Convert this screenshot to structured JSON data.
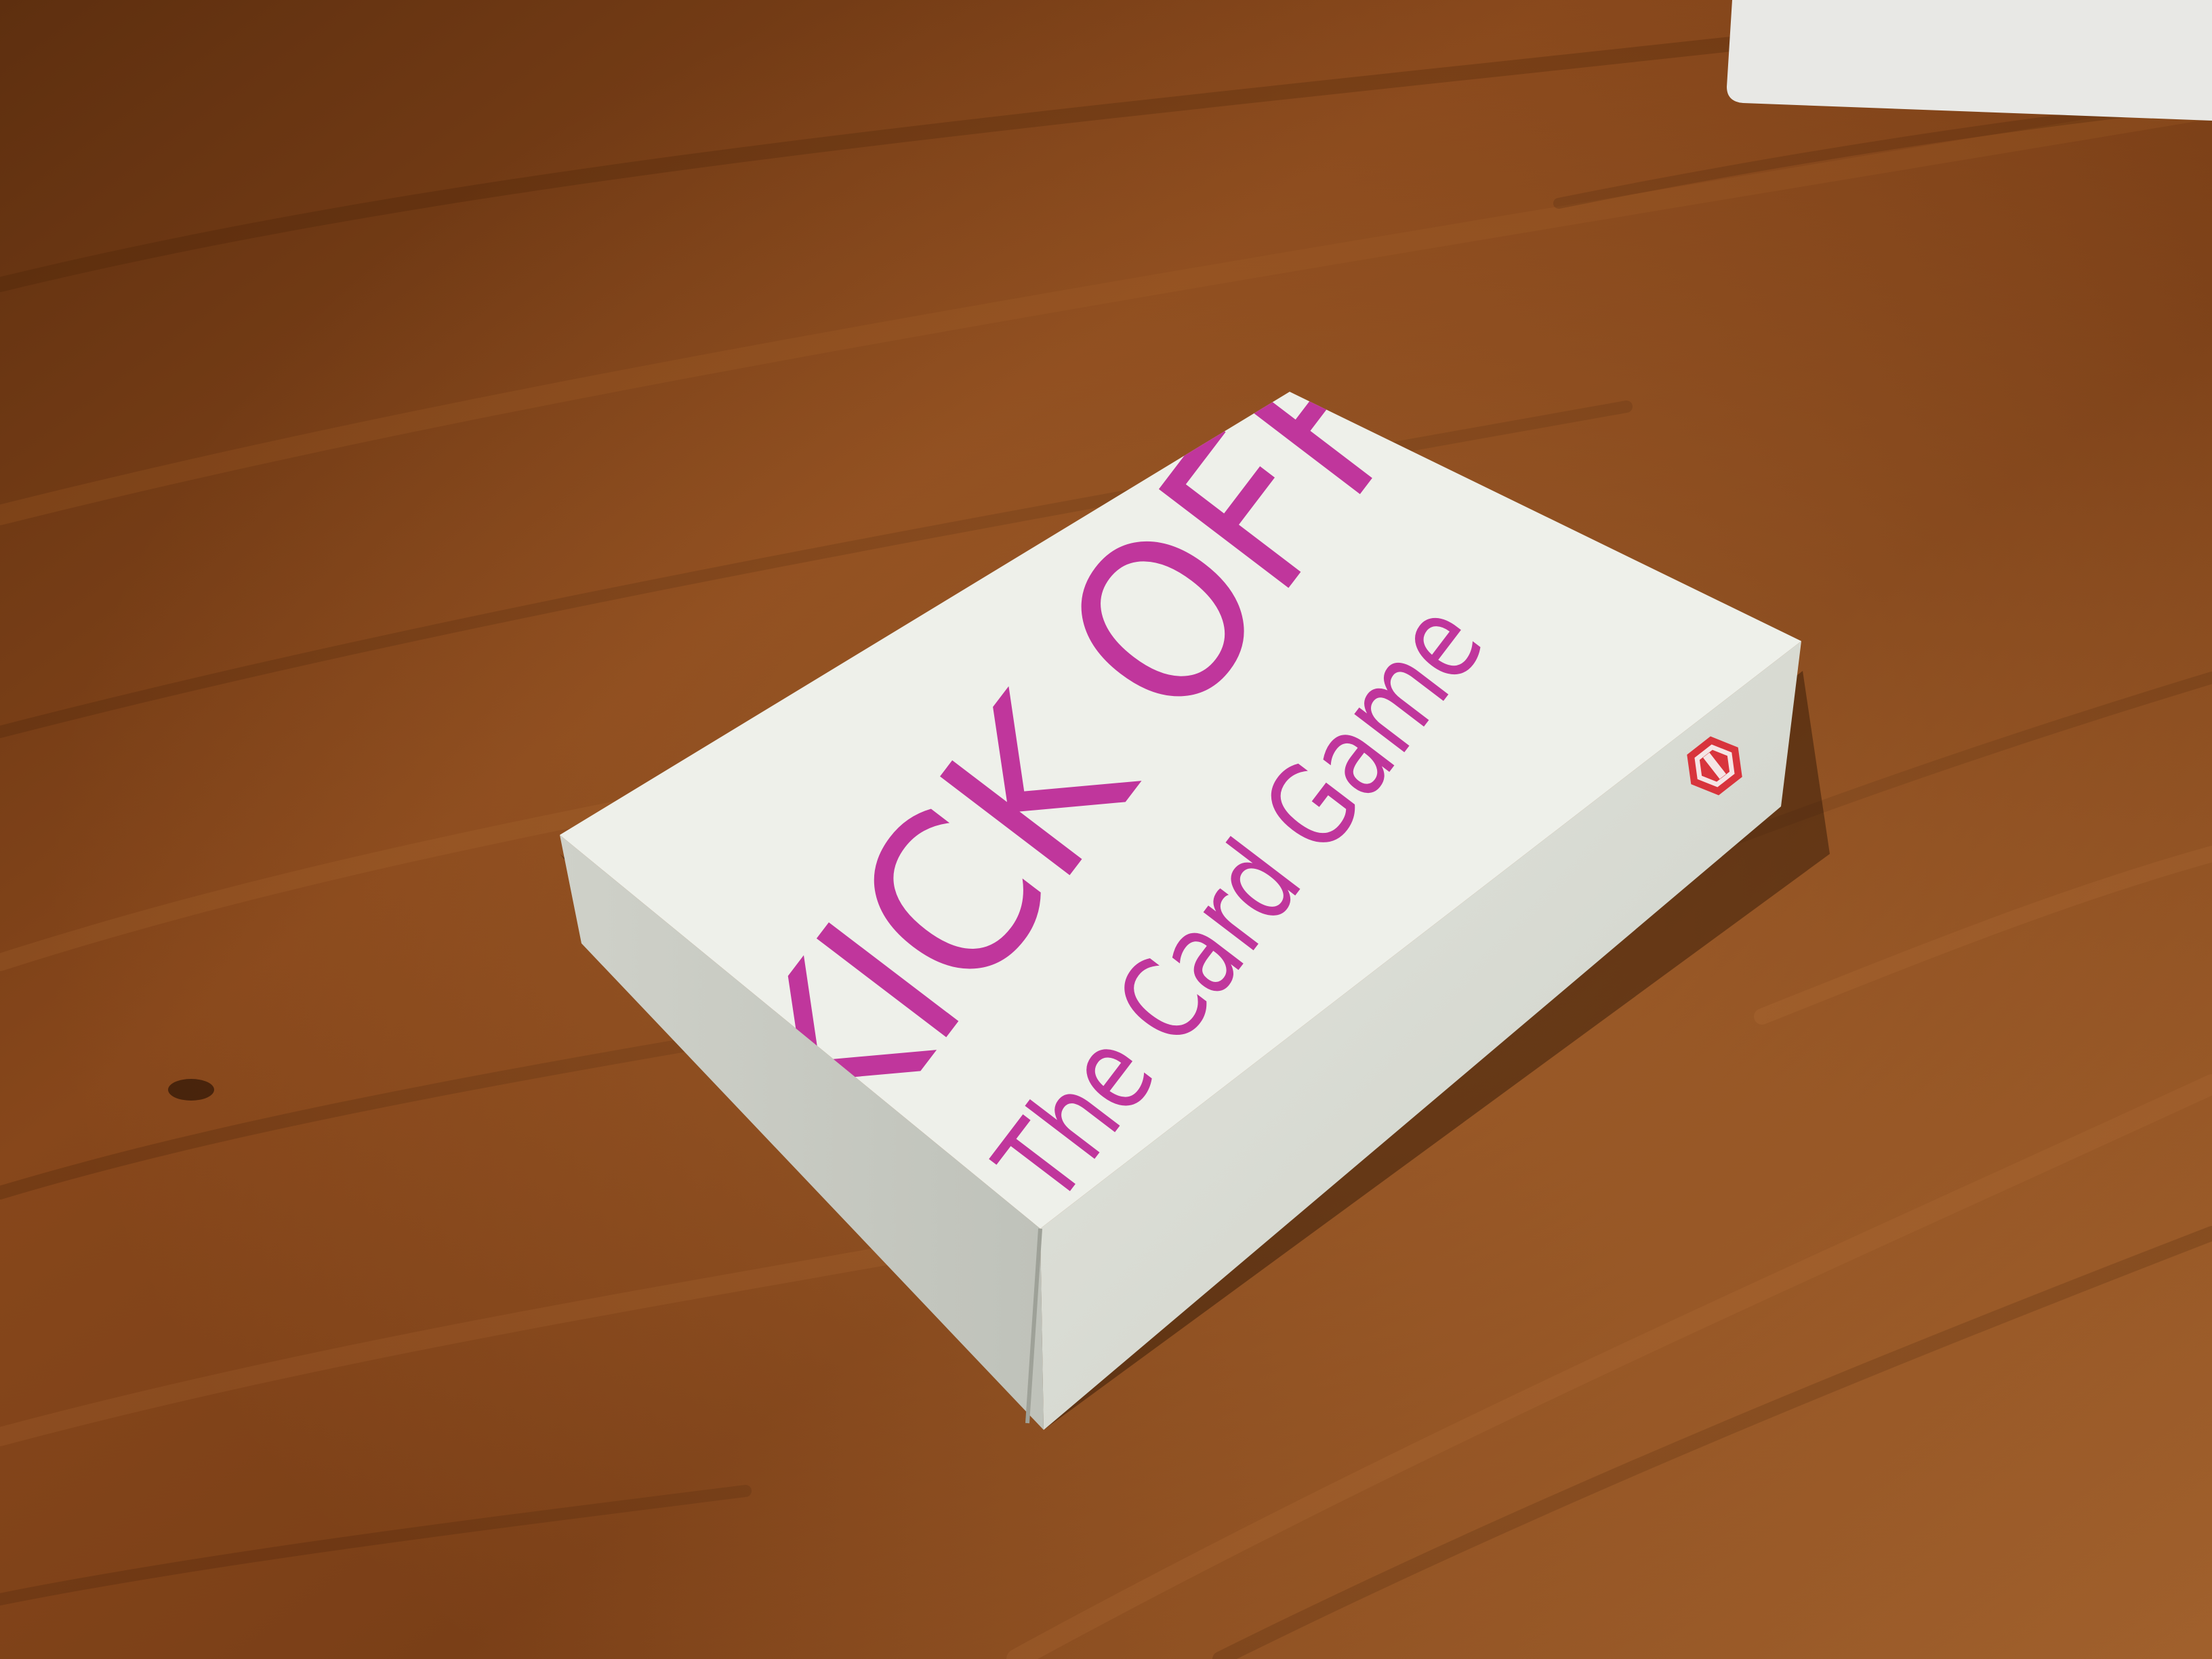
{
  "scene": {
    "description_free": true,
    "colors": {
      "wood_dark": "#5a2c0e",
      "wood_mid": "#7e4219",
      "wood_light": "#a35f2a",
      "box_top": "#eef0ea",
      "box_side": "#d9dbd3",
      "box_front": "#c9ccc4",
      "print_magenta": "#c0369c",
      "logo_red": "#d8343c",
      "bg_object": "#e9e9e6"
    }
  },
  "box": {
    "title_line1": "KICK OFF",
    "title_line2": "The Card Game",
    "logo_icon": "hexagon-logo-icon"
  }
}
